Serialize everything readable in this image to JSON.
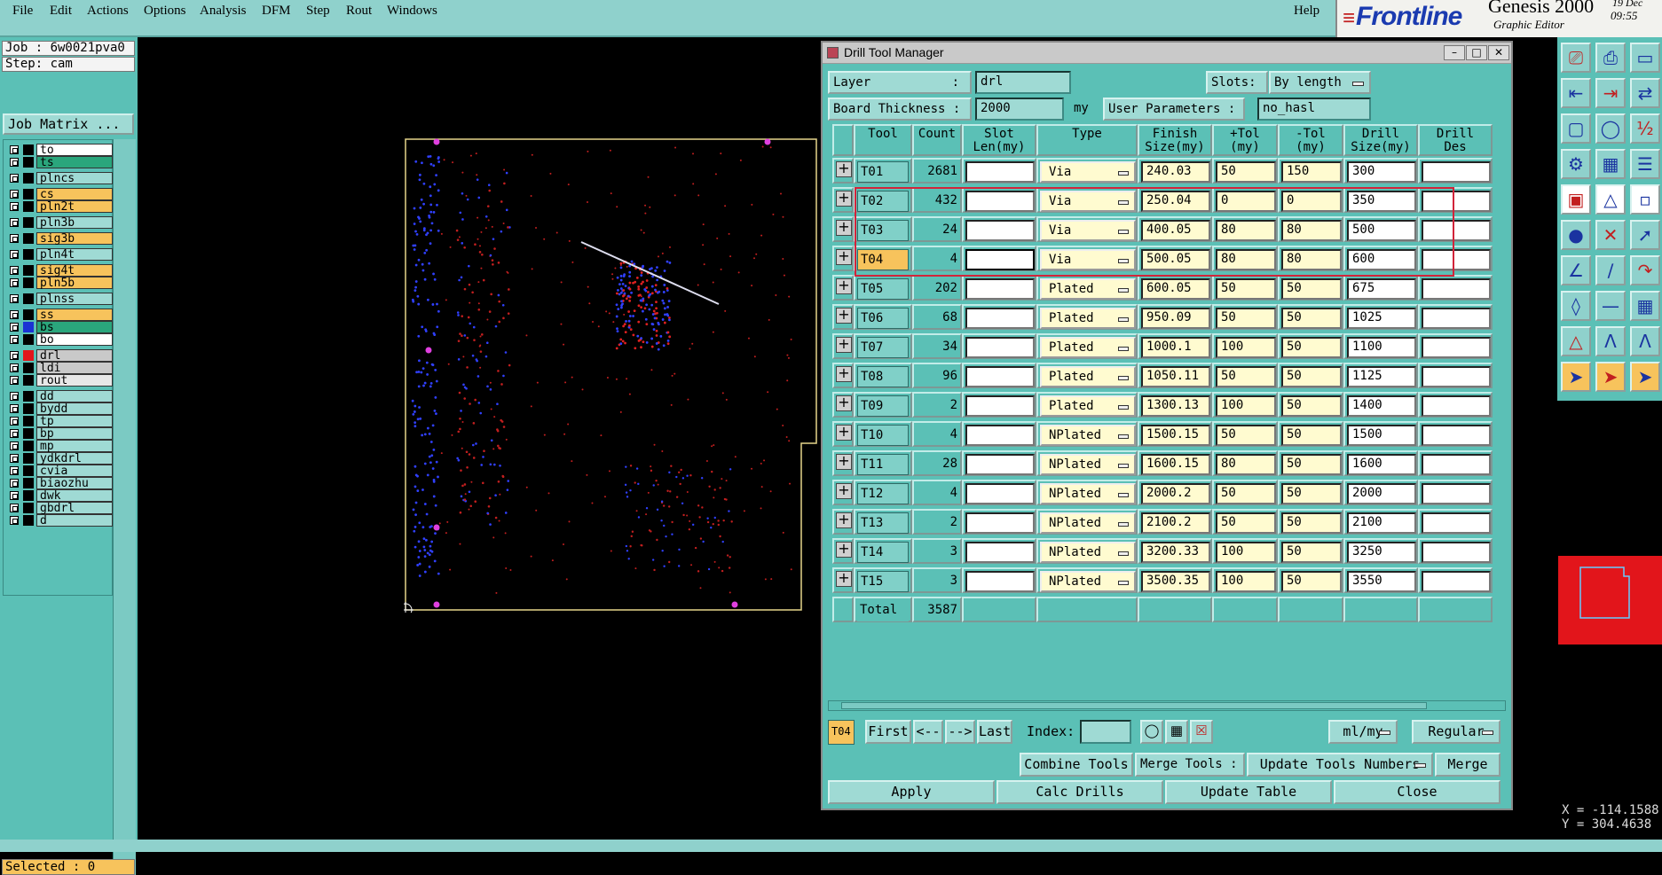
{
  "menu": {
    "items": [
      "File",
      "Edit",
      "Actions",
      "Options",
      "Analysis",
      "DFM",
      "Step",
      "Rout",
      "Windows"
    ],
    "help": "Help"
  },
  "brand": {
    "logo": "Frontline",
    "product": "Genesis 2000",
    "subtitle": "Graphic Editor",
    "time1": "19 Dec",
    "time2": "09:55"
  },
  "job": {
    "job": "Job : 6w0021pva0",
    "step": "Step: cam",
    "matrix_button": "Job Matrix ...",
    "selected": "Selected : 0"
  },
  "layers": [
    {
      "name": "to",
      "bg": "#ffffff",
      "color": "#000000"
    },
    {
      "name": "ts",
      "bg": "#2aa67c",
      "color": "#000000"
    },
    {
      "name": "plncs",
      "bg": "#9fdad4",
      "color": "#000000"
    },
    {
      "name": "cs",
      "bg": "#f7c35c",
      "color": "#000000"
    },
    {
      "name": "pln2t",
      "bg": "#f7c35c",
      "color": "#000000"
    },
    {
      "name": "pln3b",
      "bg": "#9fdad4",
      "color": "#000000"
    },
    {
      "name": "sig3b",
      "bg": "#f7c35c",
      "color": "#000000"
    },
    {
      "name": "pln4t",
      "bg": "#9fdad4",
      "color": "#000000"
    },
    {
      "name": "sig4t",
      "bg": "#f7c35c",
      "color": "#000000"
    },
    {
      "name": "pln5b",
      "bg": "#f7c35c",
      "color": "#000000"
    },
    {
      "name": "plnss",
      "bg": "#9fdad4",
      "color": "#000000"
    },
    {
      "name": "ss",
      "bg": "#f7c35c",
      "color": "#000000"
    },
    {
      "name": "bs",
      "bg": "#2aa67c",
      "color": "#1a33d4"
    },
    {
      "name": "bo",
      "bg": "#ffffff",
      "color": "#000000"
    },
    {
      "name": "drl",
      "bg": "#c9c9c9",
      "color": "#e2151b"
    },
    {
      "name": "ldi",
      "bg": "#c9c9c9",
      "color": "#000000"
    },
    {
      "name": "rout",
      "bg": "#e8e8e8",
      "color": "#000000"
    },
    {
      "name": "dd",
      "bg": "#9fdad4",
      "color": "#000000"
    },
    {
      "name": "bydd",
      "bg": "#9fdad4",
      "color": "#000000"
    },
    {
      "name": "tp",
      "bg": "#9fdad4",
      "color": "#000000"
    },
    {
      "name": "bp",
      "bg": "#9fdad4",
      "color": "#000000"
    },
    {
      "name": "mp",
      "bg": "#9fdad4",
      "color": "#000000"
    },
    {
      "name": "ydkdrl",
      "bg": "#9fdad4",
      "color": "#000000"
    },
    {
      "name": "cvia",
      "bg": "#9fdad4",
      "color": "#000000"
    },
    {
      "name": "biaozhu",
      "bg": "#9fdad4",
      "color": "#000000"
    },
    {
      "name": "dwk",
      "bg": "#9fdad4",
      "color": "#000000"
    },
    {
      "name": "gbdrl",
      "bg": "#9fdad4",
      "color": "#000000"
    },
    {
      "name": "d",
      "bg": "#9fdad4",
      "color": "#000000"
    }
  ],
  "dialog": {
    "title": "Drill Tool Manager",
    "layer_label": "Layer",
    "layer_sep": ":",
    "layer_value": "drl",
    "slots_label": "Slots:",
    "slots_value": "By length",
    "thickness_label": "Board Thickness :",
    "thickness_value": "2000",
    "thickness_unit": "my",
    "user_params_label": "User Parameters :",
    "user_params_value": "no_hasl",
    "columns": [
      "Tool",
      "Count",
      "Slot\nLen(my)",
      "Type",
      "Finish\nSize(my)",
      "+Tol\n(my)",
      "-Tol\n(my)",
      "Drill\nSize(my)",
      "Drill\nDes"
    ],
    "rows": [
      {
        "tool": "T01",
        "count": "2681",
        "type": "Via",
        "finish": "240.03",
        "ptol": "50",
        "ntol": "150",
        "drill": "300"
      },
      {
        "tool": "T02",
        "count": "432",
        "type": "Via",
        "finish": "250.04",
        "ptol": "0",
        "ntol": "0",
        "drill": "350"
      },
      {
        "tool": "T03",
        "count": "24",
        "type": "Via",
        "finish": "400.05",
        "ptol": "80",
        "ntol": "80",
        "drill": "500"
      },
      {
        "tool": "T04",
        "count": "4",
        "type": "Via",
        "finish": "500.05",
        "ptol": "80",
        "ntol": "80",
        "drill": "600"
      },
      {
        "tool": "T05",
        "count": "202",
        "type": "Plated",
        "finish": "600.05",
        "ptol": "50",
        "ntol": "50",
        "drill": "675"
      },
      {
        "tool": "T06",
        "count": "68",
        "type": "Plated",
        "finish": "950.09",
        "ptol": "50",
        "ntol": "50",
        "drill": "1025"
      },
      {
        "tool": "T07",
        "count": "34",
        "type": "Plated",
        "finish": "1000.1",
        "ptol": "100",
        "ntol": "50",
        "drill": "1100"
      },
      {
        "tool": "T08",
        "count": "96",
        "type": "Plated",
        "finish": "1050.11",
        "ptol": "50",
        "ntol": "50",
        "drill": "1125"
      },
      {
        "tool": "T09",
        "count": "2",
        "type": "Plated",
        "finish": "1300.13",
        "ptol": "100",
        "ntol": "50",
        "drill": "1400"
      },
      {
        "tool": "T10",
        "count": "4",
        "type": "NPlated",
        "finish": "1500.15",
        "ptol": "50",
        "ntol": "50",
        "drill": "1500"
      },
      {
        "tool": "T11",
        "count": "28",
        "type": "NPlated",
        "finish": "1600.15",
        "ptol": "80",
        "ntol": "50",
        "drill": "1600"
      },
      {
        "tool": "T12",
        "count": "4",
        "type": "NPlated",
        "finish": "2000.2",
        "ptol": "50",
        "ntol": "50",
        "drill": "2000"
      },
      {
        "tool": "T13",
        "count": "2",
        "type": "NPlated",
        "finish": "2100.2",
        "ptol": "50",
        "ntol": "50",
        "drill": "2100"
      },
      {
        "tool": "T14",
        "count": "3",
        "type": "NPlated",
        "finish": "3200.33",
        "ptol": "100",
        "ntol": "50",
        "drill": "3250"
      },
      {
        "tool": "T15",
        "count": "3",
        "type": "NPlated",
        "finish": "3500.35",
        "ptol": "100",
        "ntol": "50",
        "drill": "3550"
      }
    ],
    "total_label": "Total",
    "total_value": "3587",
    "current_tool": "T04",
    "nav": {
      "first": "First",
      "prev": "<--",
      "next": "-->",
      "last": "Last",
      "index_label": "Index:",
      "units": "ml/my",
      "mode": "Regular"
    },
    "combine": "Combine Tools",
    "merge_label": "Merge Tools :",
    "merge_option": "Update Tools Numbers",
    "merge": "Merge",
    "apply": "Apply",
    "calc": "Calc Drills",
    "update": "Update Table",
    "close": "Close"
  },
  "coords": {
    "x": "X = -114.1588",
    "y": "Y = 304.4638"
  }
}
